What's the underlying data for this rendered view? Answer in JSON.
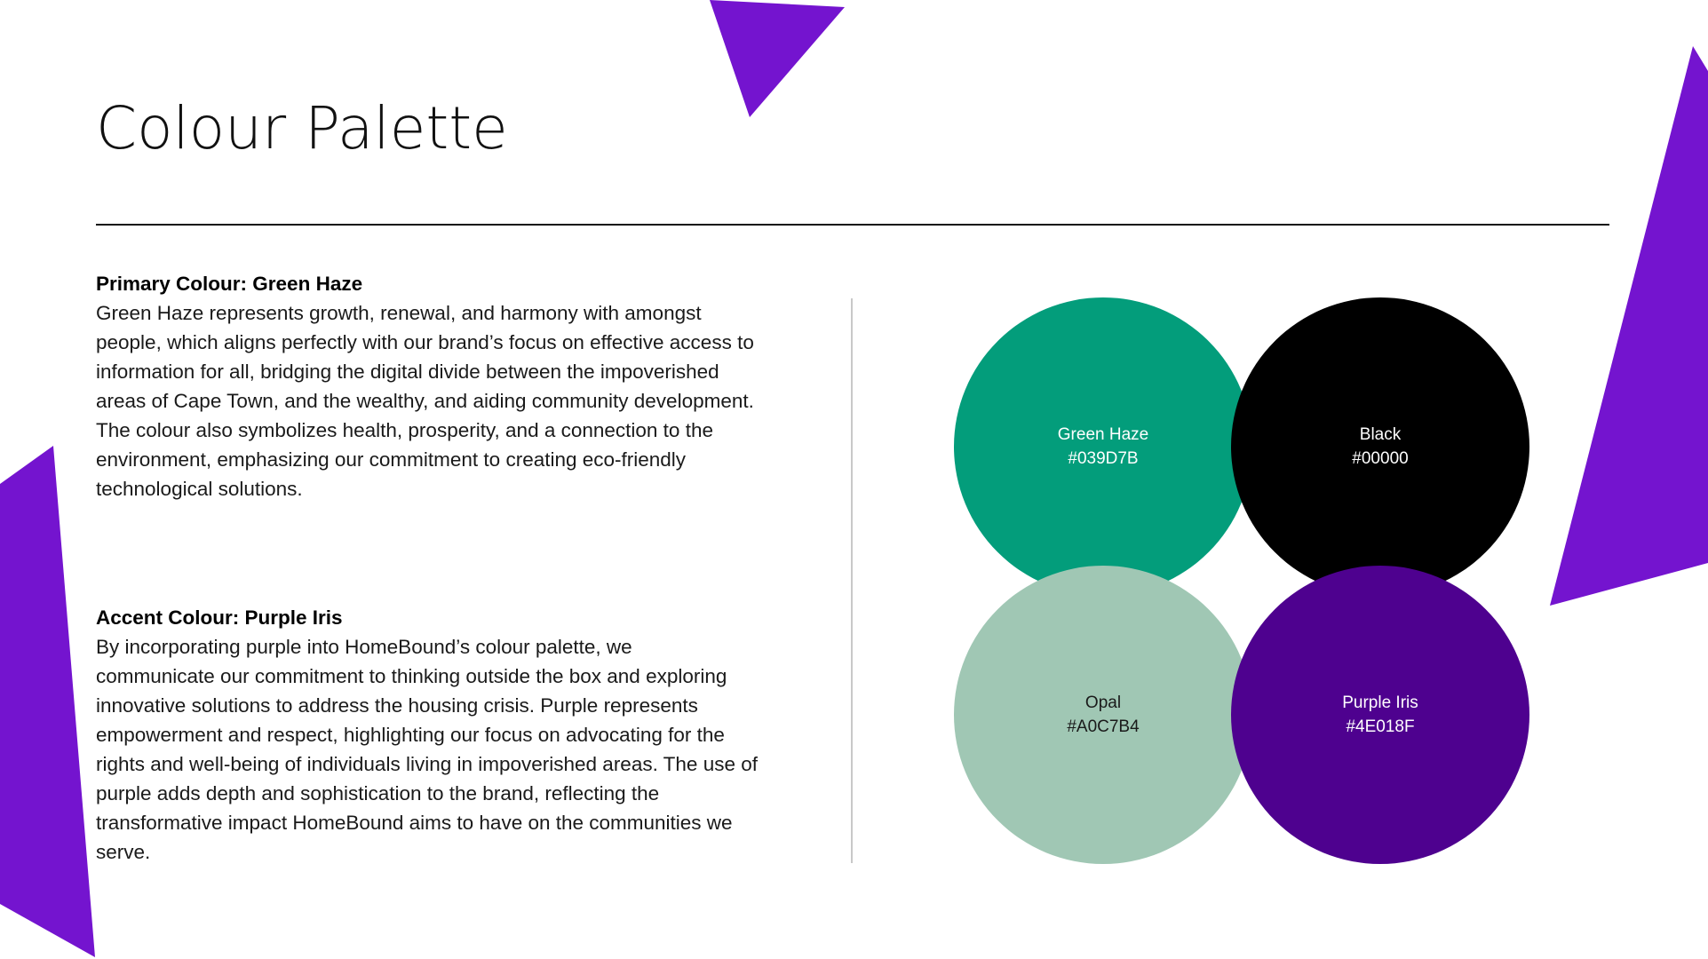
{
  "page": {
    "title": "Colour Palette"
  },
  "primary_section": {
    "heading": "Primary Colour: Green Haze",
    "lines": [
      "Green Haze represents growth, renewal, and harmony with amongst",
      "people, which aligns perfectly with our brand’s focus on effective access to",
      "information for all, bridging the digital divide between the impoverished",
      "areas of Cape Town, and the wealthy, and aiding community development.",
      "The  colour also symbolizes health, prosperity, and a connection to the",
      "environment, emphasizing our commitment to creating eco-friendly",
      "technological solutions."
    ]
  },
  "accent_section": {
    "heading": "Accent Colour: Purple Iris",
    "lines": [
      "By incorporating purple into HomeBound’s colour palette, we",
      "communicate our commitment to thinking outside the box and exploring",
      "innovative solutions to address the housing crisis. Purple represents",
      "empowerment and respect, highlighting our focus on advocating for the",
      "rights and well-being of individuals living in impoverished areas. The use of",
      "purple adds depth and sophistication to the brand, reflecting the",
      "transformative impact HomeBound aims to have on the communities we",
      "serve."
    ]
  },
  "swatches": [
    {
      "name": "Green Haze",
      "hex": "#039D7B",
      "fill": "#039D7B",
      "text_color": "#ffffff"
    },
    {
      "name": "Black",
      "hex": "#00000",
      "fill": "#000000",
      "text_color": "#ffffff"
    },
    {
      "name": "Opal",
      "hex": "#A0C7B4",
      "fill": "#A0C7B4",
      "text_color": "#1a1a1a"
    },
    {
      "name": "Purple Iris",
      "hex": "#4E018F",
      "fill": "#4E018F",
      "text_color": "#ffffff"
    }
  ],
  "colors": {
    "decor_purple": "#7414CF",
    "rule": "#111111",
    "divider": "#c8c8c8"
  }
}
